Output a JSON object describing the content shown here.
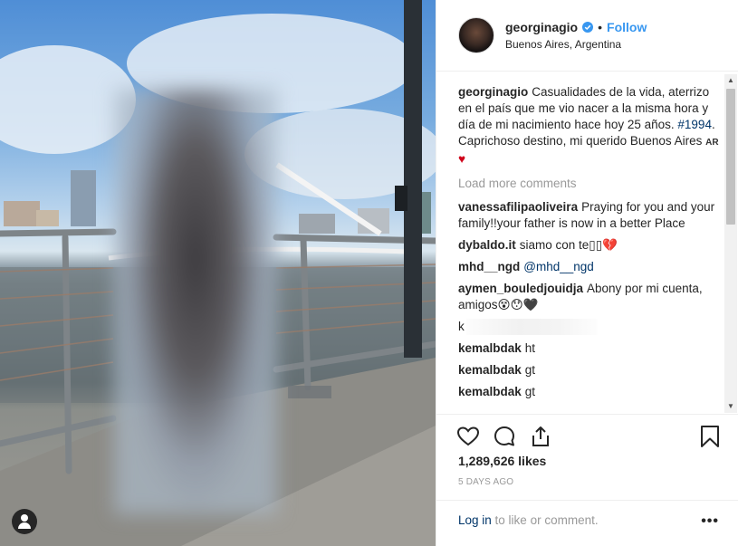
{
  "post": {
    "username": "georginagio",
    "follow_label": "Follow",
    "separator": "•",
    "location": "Buenos Aires, Argentina",
    "caption": {
      "username": "georginagio",
      "text_before": "Casualidades de la vida, aterrizo en el país que me vio nacer a la misma hora y día de mi nacimiento hace hoy 25 años. ",
      "hashtag": "#1994",
      "text_after": ". Caprichoso destino, mi querido Buenos Aires ",
      "flag": "AR",
      "heart": "♥"
    },
    "load_more": "Load more comments",
    "comments": [
      {
        "user": "vanessafilipaoliveira",
        "text": "Praying for you and your family!!your father is now in a better Place"
      },
      {
        "user": "dybaldo.it",
        "text": "siamo con te▯▯💔"
      },
      {
        "user": "mhd__ngd",
        "text": "",
        "mention": "@mhd__ngd"
      },
      {
        "user": "aymen_bouledjouidja",
        "text": "Abony por mi cuenta, amigos😵😯🖤"
      },
      {
        "user": "k",
        "text": ""
      },
      {
        "user": "kemalbdak",
        "text": "ht"
      },
      {
        "user": "kemalbdak",
        "text": "gt"
      },
      {
        "user": "kemalbdak",
        "text": "gt"
      }
    ],
    "likes": "1,289,626 likes",
    "time_ago": "5 DAYS AGO",
    "login_link": "Log in",
    "login_rest": " to like or comment.",
    "more": "•••"
  },
  "scrollbar": {
    "up": "▲",
    "down": "▼"
  },
  "icons": {
    "verified": "verified-badge-icon",
    "like": "heart-icon",
    "comment": "comment-icon",
    "share": "share-icon",
    "save": "bookmark-icon",
    "user_tag": "user-tag-icon"
  },
  "colors": {
    "link_blue": "#3897f0",
    "mention": "#003569",
    "muted": "#999999",
    "verified": "#3897f0"
  }
}
